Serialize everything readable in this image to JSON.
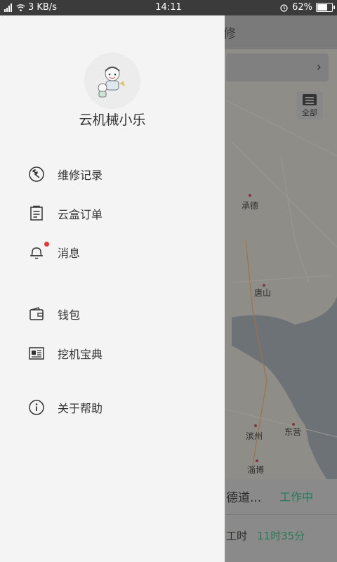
{
  "status_bar": {
    "left_text": "3 KB/s",
    "time": "14:11",
    "battery": "62%"
  },
  "map_topbar": {
    "partial_text": "修"
  },
  "map": {
    "all_label": "全部",
    "cities": [
      "承德",
      "唐山",
      "滨州",
      "东营",
      "淄博"
    ]
  },
  "info_card": {
    "name": "德道...",
    "state": "工作中",
    "hours_label": "工时",
    "hours_value": "11时35分"
  },
  "drawer": {
    "username": "云机械小乐",
    "items": [
      {
        "label": "维修记录",
        "icon": "wrench-icon"
      },
      {
        "label": "云盒订单",
        "icon": "order-list-icon"
      },
      {
        "label": "消息",
        "icon": "bell-icon"
      },
      {
        "label": "钱包",
        "icon": "wallet-icon"
      },
      {
        "label": "挖机宝典",
        "icon": "book-icon"
      },
      {
        "label": "关于帮助",
        "icon": "info-icon"
      }
    ]
  },
  "colors": {
    "drawer_bg": "#f4f4f4",
    "accent_green": "#2b7a5a",
    "badge_red": "#e53935"
  }
}
